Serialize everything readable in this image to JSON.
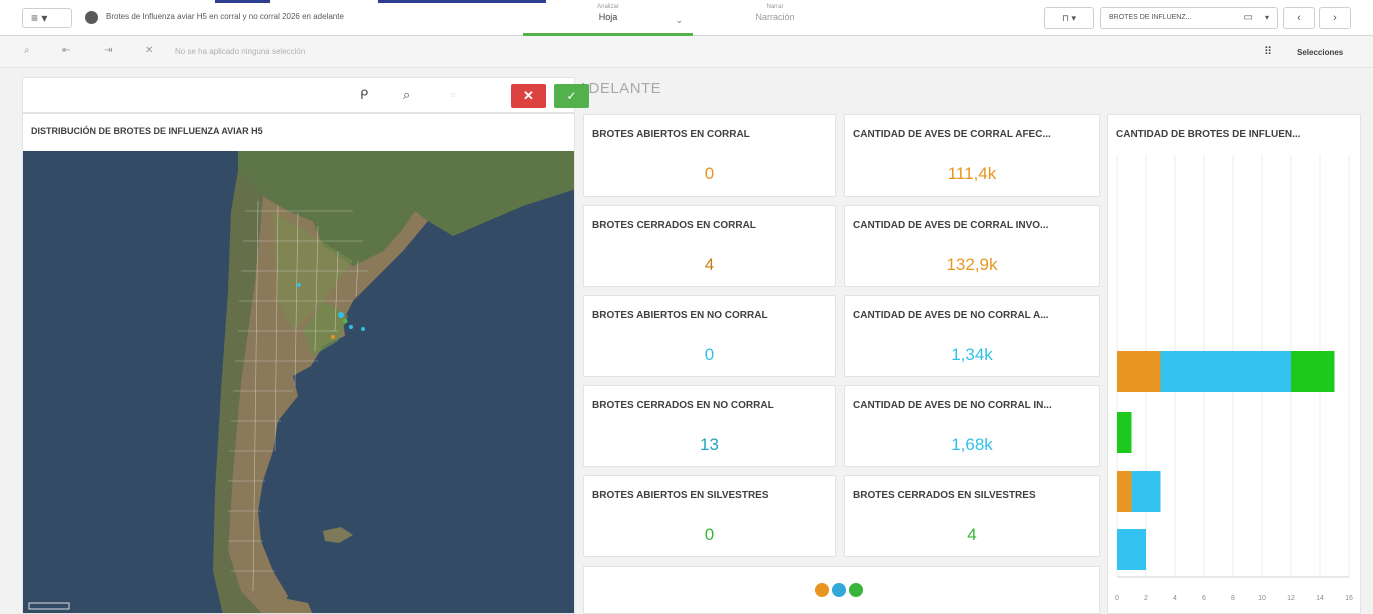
{
  "topbar": {
    "menu_icon": "hamburger-icon",
    "menu_chevron": "▾",
    "app_icon": "globe-icon",
    "app_title": "Brotes de Influenza aviar H5 en corral y no corral 2026 en adelante",
    "mode_analizar_label": "Analizar",
    "mode_analizar_value": "Hoja",
    "mode_chevron": "⌄",
    "mode_narrar_label": "Narrar",
    "mode_narrar_value": "Narración",
    "bookmark_icon": "bookmark-icon",
    "bookmark_glyph": "⊓ ▾",
    "sheet_selector": "BROTES DE INFLUENZ...",
    "device_glyph": "▭",
    "sheet_chevron": "▾",
    "prev": "‹",
    "next": "›"
  },
  "selections_bar": {
    "text": "No se ha aplicado ninguna selección",
    "label": "Selecciones",
    "grid_glyph": "⠿"
  },
  "sheet": {
    "title": "ADELANTE"
  },
  "map": {
    "title": "DISTRIBUCIÓN DE BROTES DE INFLUENZA AVIAR H5",
    "toolbar": {
      "lasso": "ᑭ",
      "search": "⌕",
      "clear": "✕",
      "confirm": "✓"
    }
  },
  "kpis": [
    {
      "title": "BROTES ABIERTOS EN CORRAL",
      "value": "0",
      "color": "#e89522"
    },
    {
      "title": "CANTIDAD DE AVES DE CORRAL AFEC...",
      "value": "111,4k",
      "color": "#e89522"
    },
    {
      "title": "BROTES CERRADOS EN CORRAL",
      "value": "4",
      "color": "#c77d18"
    },
    {
      "title": "CANTIDAD DE AVES DE CORRAL INVO...",
      "value": "132,9k",
      "color": "#e89522"
    },
    {
      "title": "BROTES ABIERTOS EN NO CORRAL",
      "value": "0",
      "color": "#31c1e8"
    },
    {
      "title": "CANTIDAD DE AVES DE NO CORRAL A...",
      "value": "1,34k",
      "color": "#31c1e8"
    },
    {
      "title": "BROTES CERRADOS EN NO CORRAL",
      "value": "13",
      "color": "#22a3be"
    },
    {
      "title": "CANTIDAD DE AVES DE NO CORRAL IN...",
      "value": "1,68k",
      "color": "#31c1e8"
    },
    {
      "title": "BROTES ABIERTOS EN SILVESTRES",
      "value": "0",
      "color": "#3ab43a"
    },
    {
      "title": "BROTES CERRADOS EN SILVESTRES",
      "value": "4",
      "color": "#3ab43a"
    }
  ],
  "legend_colors": [
    "#e89522",
    "#31a8d8",
    "#3ab43a"
  ],
  "chart_data": {
    "type": "bar",
    "orientation": "horizontal",
    "stacked": true,
    "title": "CANTIDAD DE BROTES DE INFLUEN...",
    "xlim": [
      0,
      16
    ],
    "x_ticks": [
      "0",
      "2",
      "4",
      "6",
      "8",
      "10",
      "12",
      "14",
      "16"
    ],
    "grid": true,
    "series": [
      {
        "color": "#e89522",
        "values": [
          3,
          0,
          1,
          0
        ]
      },
      {
        "color": "#34c3f1",
        "values": [
          9,
          0,
          2,
          2
        ]
      },
      {
        "color": "#1ec91e",
        "values": [
          3,
          1,
          0,
          0
        ]
      }
    ]
  }
}
